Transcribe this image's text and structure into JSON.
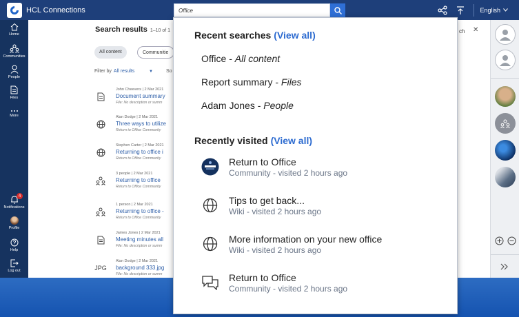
{
  "app": {
    "title": "HCL Connections",
    "language": "English"
  },
  "search": {
    "value": "Office"
  },
  "left_nav": [
    {
      "label": "Home",
      "icon": "home-icon"
    },
    {
      "label": "Communities",
      "icon": "communities-icon"
    },
    {
      "label": "People",
      "icon": "person-icon"
    },
    {
      "label": "Files",
      "icon": "file-icon"
    },
    {
      "label": "More",
      "icon": "more-icon"
    },
    {
      "label": "Notifications",
      "icon": "bell-icon",
      "badge": "4"
    },
    {
      "label": "Profile",
      "icon": "avatar"
    },
    {
      "label": "Help",
      "icon": "help-icon"
    },
    {
      "label": "Log out",
      "icon": "logout-icon"
    }
  ],
  "background": {
    "heading": "Search results",
    "range": "1–10 of 1",
    "right_text": "ch",
    "chips": [
      "All content",
      "Communitie"
    ],
    "filter_label": "Filter by",
    "filter_value": "All results",
    "sort_label": "So",
    "results": [
      {
        "icon": "document-icon",
        "meta": "John Cheevers | 2 Mar 2021",
        "title": "Document summary",
        "sub": "File: No description or summ"
      },
      {
        "icon": "globe-icon",
        "meta": "Alan Dodge | 2 Mar 2021",
        "title": "Three ways to utilize",
        "sub": "Return to Office Community"
      },
      {
        "icon": "globe-icon",
        "meta": "Stephen Carter | 2 Mar 2021",
        "title": "Returning to office i",
        "sub": "Return to Office Community"
      },
      {
        "icon": "people-icon",
        "meta": "3 people | 2 Mar 2021",
        "title": "Returning to office",
        "sub": "Return to Office Community"
      },
      {
        "icon": "people-icon",
        "meta": "1 person | 2 Mar 2021",
        "title": "Returning to office -",
        "sub": "Return to Office Community"
      },
      {
        "icon": "document-icon",
        "meta": "James Jones | 2 Mar 2021",
        "title": "Meeting minutes all",
        "sub": "File: No description or summ"
      },
      {
        "icon": "jpg-icon",
        "icon_text": "JPG",
        "meta": "Alan Dodge | 2 Mar 2021",
        "title": "background 333.jpg",
        "sub": "File: No description or summ"
      }
    ]
  },
  "dropdown": {
    "recent_searches": {
      "title": "Recent searches",
      "view_all": "(View all)",
      "items": [
        {
          "query": "Office",
          "scope": "All content"
        },
        {
          "query": "Report summary",
          "scope": "Files"
        },
        {
          "query": "Adam Jones",
          "scope": "People"
        }
      ]
    },
    "recently_visited": {
      "title": "Recently visited",
      "view_all": "(View all)",
      "items": [
        {
          "icon": "community-logo-icon",
          "title": "Return to Office",
          "sub": "Community - visited 2 hours ago"
        },
        {
          "icon": "globe-icon",
          "title": "Tips to get back...",
          "sub": "Wiki - visited 2 hours ago"
        },
        {
          "icon": "globe-icon",
          "title": "More information on your new office",
          "sub": "Wiki - visited 2 hours ago"
        },
        {
          "icon": "forum-icon",
          "title": "Return to Office",
          "sub": "Community - visited 2 hours ago"
        }
      ]
    }
  },
  "colors": {
    "topbar": "#1e3f7a",
    "leftnav": "#16335f",
    "link": "#2d6bd0",
    "desktop": "#1a5fb4"
  }
}
